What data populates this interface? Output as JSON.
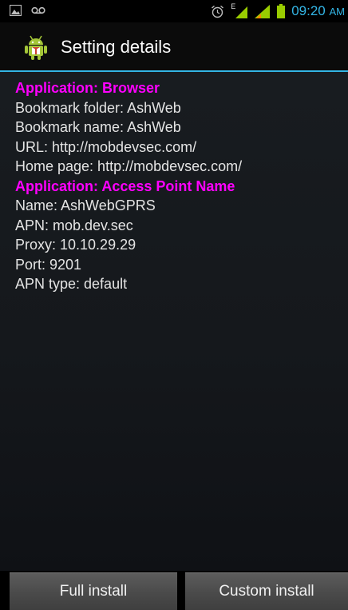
{
  "statusbar": {
    "time": "09:20",
    "ampm": "AM",
    "signal_label": "E"
  },
  "header": {
    "title": "Setting details"
  },
  "details": {
    "lines": [
      {
        "text": "Application: Browser",
        "heading": true
      },
      {
        "text": "Bookmark folder: AshWeb",
        "heading": false
      },
      {
        "text": "Bookmark name: AshWeb",
        "heading": false
      },
      {
        "text": "URL: http://mobdevsec.com/",
        "heading": false
      },
      {
        "text": "Home page: http://mobdevsec.com/",
        "heading": false
      },
      {
        "text": "Application: Access Point Name",
        "heading": true
      },
      {
        "text": "Name: AshWebGPRS",
        "heading": false
      },
      {
        "text": "APN: mob.dev.sec",
        "heading": false
      },
      {
        "text": "Proxy: 10.10.29.29",
        "heading": false
      },
      {
        "text": "Port: 9201",
        "heading": false
      },
      {
        "text": "APN type: default",
        "heading": false
      }
    ]
  },
  "buttons": {
    "full_install": "Full install",
    "custom_install": "Custom install"
  },
  "colors": {
    "accent": "#33b5e5",
    "heading": "#ff00ff",
    "signal": "#99cc00"
  }
}
